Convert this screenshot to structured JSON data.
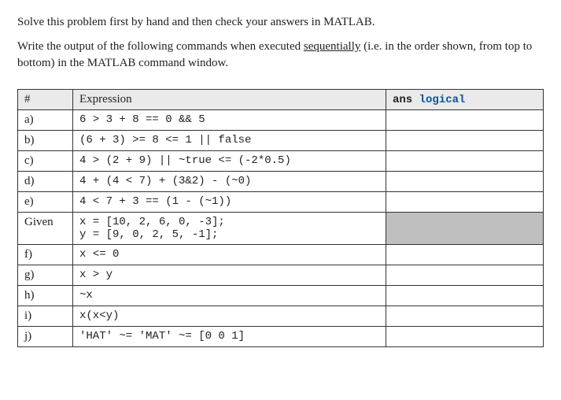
{
  "intro": {
    "p1": "Solve this problem first by hand and then check your answers in MATLAB.",
    "p2_pre": "Write the output of the following commands when executed ",
    "p2_underlined": "sequentially",
    "p2_post": " (i.e. in the order shown, from top to bottom) in the MATLAB command window."
  },
  "table": {
    "headers": {
      "id": "#",
      "expr": "Expression",
      "ans_word": "ans ",
      "ans_logical": "logical"
    },
    "rows": [
      {
        "id": "a)",
        "expr": "6 > 3 + 8 == 0 && 5",
        "ans": ""
      },
      {
        "id": "b)",
        "expr": "(6 + 3) >= 8 <= 1 || false",
        "ans": ""
      },
      {
        "id": "c)",
        "expr": "4 > (2 + 9) || ~true <= (-2*0.5)",
        "ans": ""
      },
      {
        "id": "d)",
        "expr": "4 + (4 < 7) + (3&2) - (~0)",
        "ans": ""
      },
      {
        "id": "e)",
        "expr": "4 < 7 + 3 == (1 - (~1))",
        "ans": ""
      },
      {
        "id": "Given",
        "expr": "x = [10, 2, 6, 0, -3];\ny = [9, 0, 2, 5, -1];",
        "ans": "",
        "given": true
      },
      {
        "id": "f)",
        "expr": "x <= 0",
        "ans": ""
      },
      {
        "id": "g)",
        "expr": "x > y",
        "ans": ""
      },
      {
        "id": "h)",
        "expr": "~x",
        "ans": ""
      },
      {
        "id": "i)",
        "expr": "x(x<y)",
        "ans": ""
      },
      {
        "id": "j)",
        "expr": "'HAT' ~= 'MAT' ~= [0 0 1]",
        "ans": ""
      }
    ]
  }
}
